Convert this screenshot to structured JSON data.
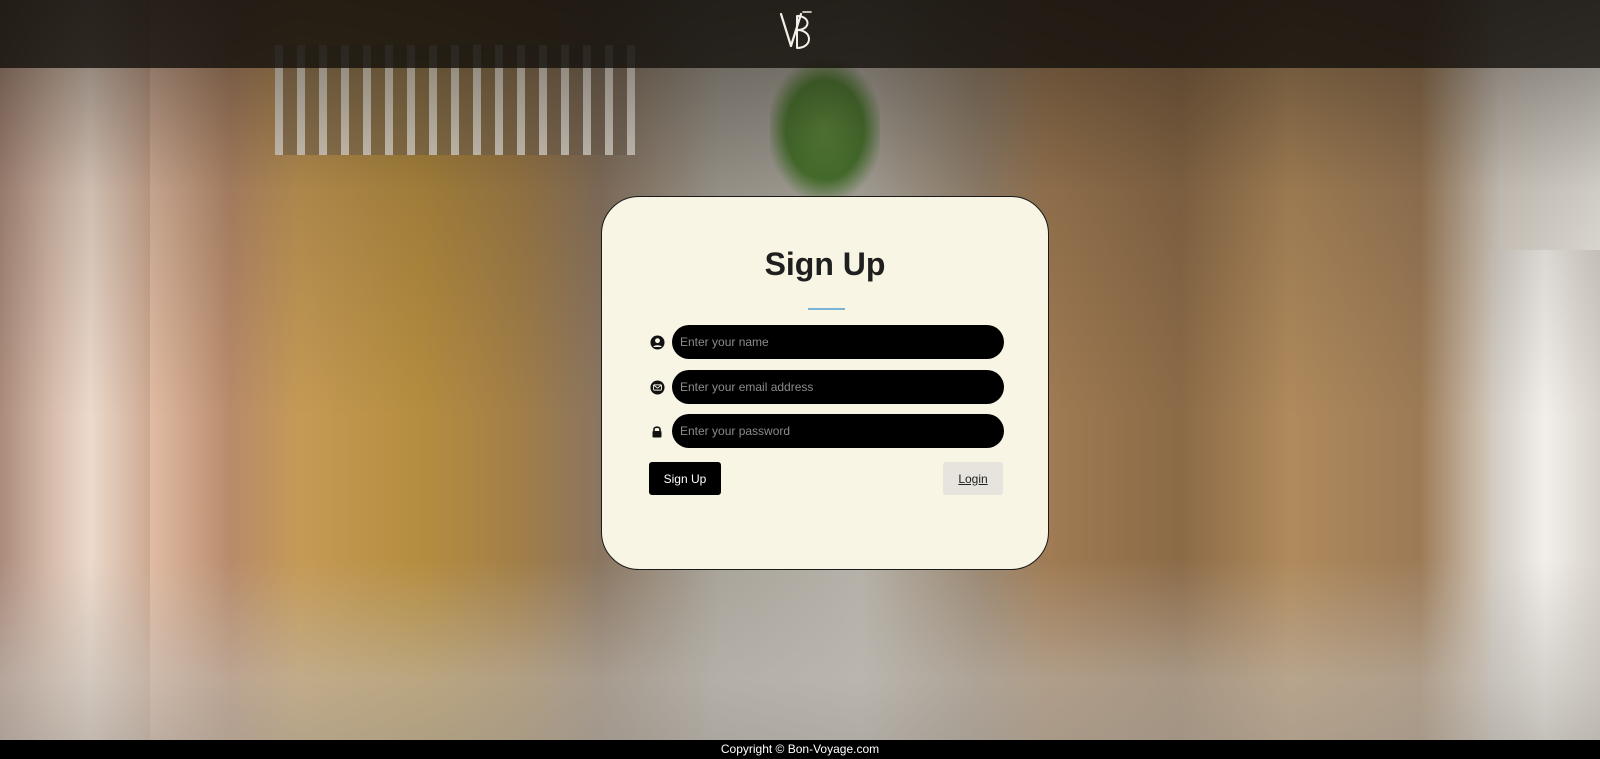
{
  "header": {
    "logo_text": "VB"
  },
  "signup_card": {
    "title": "Sign Up",
    "fields": {
      "name": {
        "placeholder": "Enter your name",
        "value": ""
      },
      "email": {
        "placeholder": "Enter your email address",
        "value": ""
      },
      "password": {
        "placeholder": "Enter your password",
        "value": ""
      }
    },
    "signup_button_label": "Sign Up",
    "login_button_label": "Login"
  },
  "footer": {
    "copyright": "Copyright © Bon-Voyage.com"
  },
  "colors": {
    "card_background": "#f8f5e4",
    "underline_accent": "#79b3d6",
    "input_background": "#000000",
    "primary_button": "#000000",
    "secondary_button": "#e6e4dc"
  },
  "icons": {
    "name": "user-circle-icon",
    "email": "envelope-icon",
    "password": "lock-icon"
  }
}
